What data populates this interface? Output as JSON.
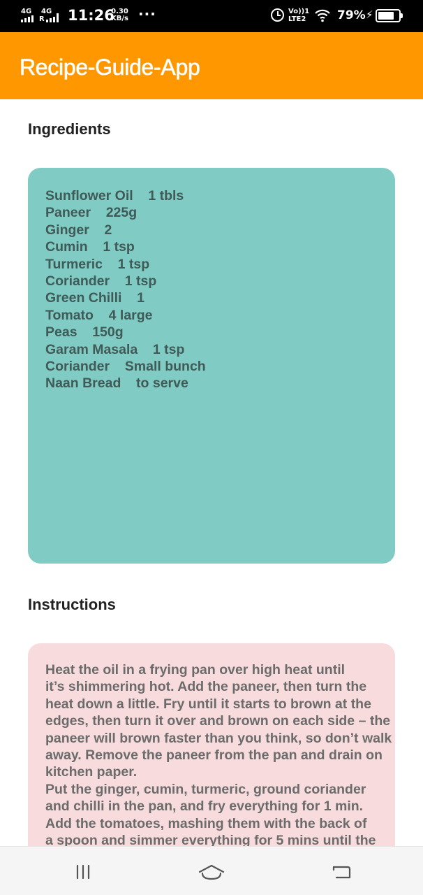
{
  "status_bar": {
    "network_1": "4G",
    "network_2": "4G",
    "roaming": "R",
    "time": "11:26",
    "speed_value": "0.30",
    "speed_unit": "KB/s",
    "overflow": "···",
    "volte_line1": "Vo))1",
    "volte_line2": "LTE2",
    "battery_percent": "79%",
    "battery_level": 0.79,
    "charging_icon": "bolt-icon"
  },
  "app_bar": {
    "title": "Recipe-Guide-App",
    "color": "#ff9800"
  },
  "ingredients": {
    "heading": "Ingredients",
    "card_color": "#80cbc4",
    "items": [
      {
        "name": "Sunflower Oil",
        "quantity": "1 tbls"
      },
      {
        "name": "Paneer",
        "quantity": "225g"
      },
      {
        "name": "Ginger",
        "quantity": "2"
      },
      {
        "name": "Cumin",
        "quantity": "1 tsp"
      },
      {
        "name": "Turmeric",
        "quantity": "1 tsp"
      },
      {
        "name": "Coriander",
        "quantity": "1 tsp"
      },
      {
        "name": "Green Chilli",
        "quantity": "1"
      },
      {
        "name": "Tomato",
        "quantity": "4 large"
      },
      {
        "name": "Peas",
        "quantity": "150g"
      },
      {
        "name": "Garam Masala",
        "quantity": "1 tsp"
      },
      {
        "name": "Coriander",
        "quantity": "Small bunch"
      },
      {
        "name": "Naan Bread",
        "quantity": "to serve"
      }
    ],
    "lines": [
      "Sunflower Oil    1 tbls",
      "Paneer    225g",
      "Ginger    2",
      "Cumin    1 tsp",
      "Turmeric    1 tsp",
      "Coriander    1 tsp",
      "Green Chilli    1",
      "Tomato    4 large",
      "Peas    150g",
      "Garam Masala    1 tsp",
      "Coriander    Small bunch",
      "Naan Bread    to serve"
    ]
  },
  "instructions": {
    "heading": "Instructions",
    "card_color": "#f8dcdd",
    "text": "Heat the oil in a frying pan over high heat until\nit’s shimmering hot. Add the paneer, then turn the\nheat down a little. Fry until it starts to brown at the\nedges, then turn it over and brown on each side – the\npaneer will brown faster than you think, so don’t walk\naway. Remove the paneer from the pan and drain on\nkitchen paper.\nPut the ginger, cumin, turmeric, ground coriander\nand chilli in the pan, and fry everything for 1 min.\nAdd the tomatoes, mashing them with the back of\na spoon and simmer everything for 5 mins until the"
  },
  "nav_bar": {
    "menu_icon": "menu-icon",
    "home_icon": "home-icon",
    "back_icon": "back-icon"
  }
}
